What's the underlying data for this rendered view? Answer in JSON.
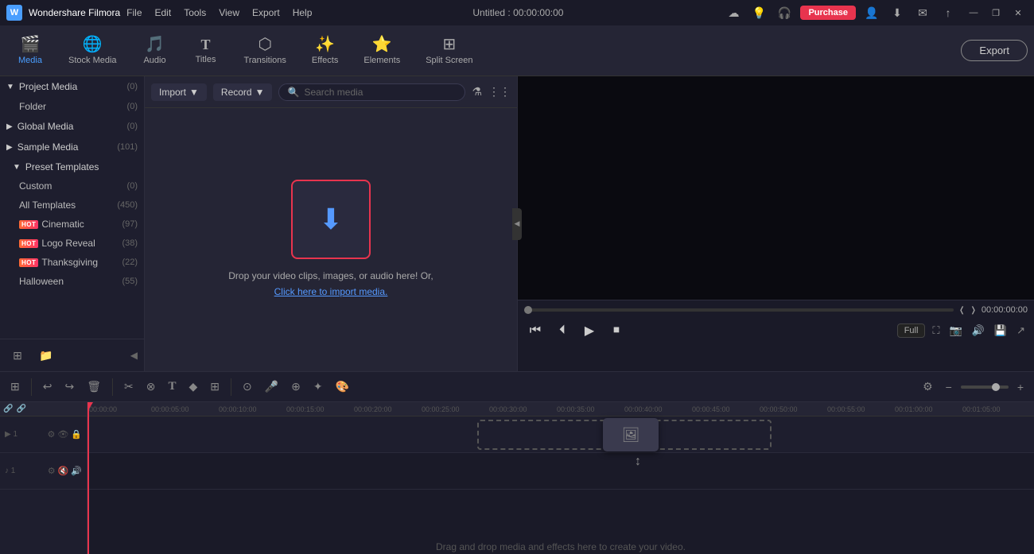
{
  "app": {
    "name": "Wondershare Filmora",
    "title": "Untitled : 00:00:00:00"
  },
  "titlebar": {
    "menu": [
      "File",
      "Edit",
      "Tools",
      "View",
      "Export",
      "Help"
    ],
    "purchase_label": "Purchase",
    "win_minimize": "—",
    "win_maximize": "❐",
    "win_close": "✕"
  },
  "toolbar": {
    "items": [
      {
        "id": "media",
        "label": "Media",
        "icon": "🎬",
        "active": true
      },
      {
        "id": "stock",
        "label": "Stock Media",
        "icon": "🌐",
        "active": false
      },
      {
        "id": "audio",
        "label": "Audio",
        "icon": "🎵",
        "active": false
      },
      {
        "id": "titles",
        "label": "Titles",
        "icon": "T",
        "active": false
      },
      {
        "id": "transitions",
        "label": "Transitions",
        "icon": "⬡",
        "active": false
      },
      {
        "id": "effects",
        "label": "Effects",
        "icon": "✨",
        "active": false
      },
      {
        "id": "elements",
        "label": "Elements",
        "icon": "⭐",
        "active": false
      },
      {
        "id": "split",
        "label": "Split Screen",
        "icon": "⊞",
        "active": false
      }
    ],
    "export_label": "Export"
  },
  "sidebar": {
    "sections": [
      {
        "id": "project-media",
        "label": "Project Media",
        "expanded": true,
        "count": "(0)",
        "children": [
          {
            "id": "folder",
            "label": "Folder",
            "count": "(0)"
          }
        ]
      },
      {
        "id": "global-media",
        "label": "Global Media",
        "expanded": false,
        "count": "(0)",
        "children": []
      },
      {
        "id": "sample-media",
        "label": "Sample Media",
        "expanded": false,
        "count": "(101)",
        "children": []
      },
      {
        "id": "preset-templates",
        "label": "Preset Templates",
        "expanded": true,
        "count": "",
        "children": [
          {
            "id": "custom",
            "label": "Custom",
            "count": "(0)",
            "hot": false
          },
          {
            "id": "all-templates",
            "label": "All Templates",
            "count": "(450)",
            "hot": false
          },
          {
            "id": "cinematic",
            "label": "Cinematic",
            "count": "(97)",
            "hot": true
          },
          {
            "id": "logo-reveal",
            "label": "Logo Reveal",
            "count": "(38)",
            "hot": true
          },
          {
            "id": "thanksgiving",
            "label": "Thanksgiving",
            "count": "(22)",
            "hot": true
          },
          {
            "id": "halloween",
            "label": "Halloween",
            "count": "(55)",
            "hot": false
          }
        ]
      }
    ],
    "bottom_icons": [
      "⊞",
      "📁"
    ]
  },
  "content": {
    "import_label": "Import",
    "record_label": "Record",
    "search_placeholder": "Search media",
    "drop_text": "Drop your video clips, images, or audio here! Or,",
    "drop_link": "Click here to import media."
  },
  "preview": {
    "time_current": "00:00:00:00",
    "time_total": "00:00:00:00",
    "resolution_label": "Full"
  },
  "timeline": {
    "toolbar_buttons": [
      "⊞",
      "↩",
      "↪",
      "🗑",
      "✂",
      "⊗",
      "T",
      "⊕",
      "⊞"
    ],
    "zoom_label": "Zoom",
    "drag_hint": "Drag and drop media and effects here to create your video.",
    "ruler_times": [
      "00:05:00",
      "00:10:00",
      "00:15:00",
      "00:20:00",
      "00:25:00",
      "00:30:00",
      "00:35:00",
      "00:40:00",
      "00:45:00",
      "00:50:00",
      "00:55:00",
      "01:00:00",
      "01:05:00"
    ]
  }
}
